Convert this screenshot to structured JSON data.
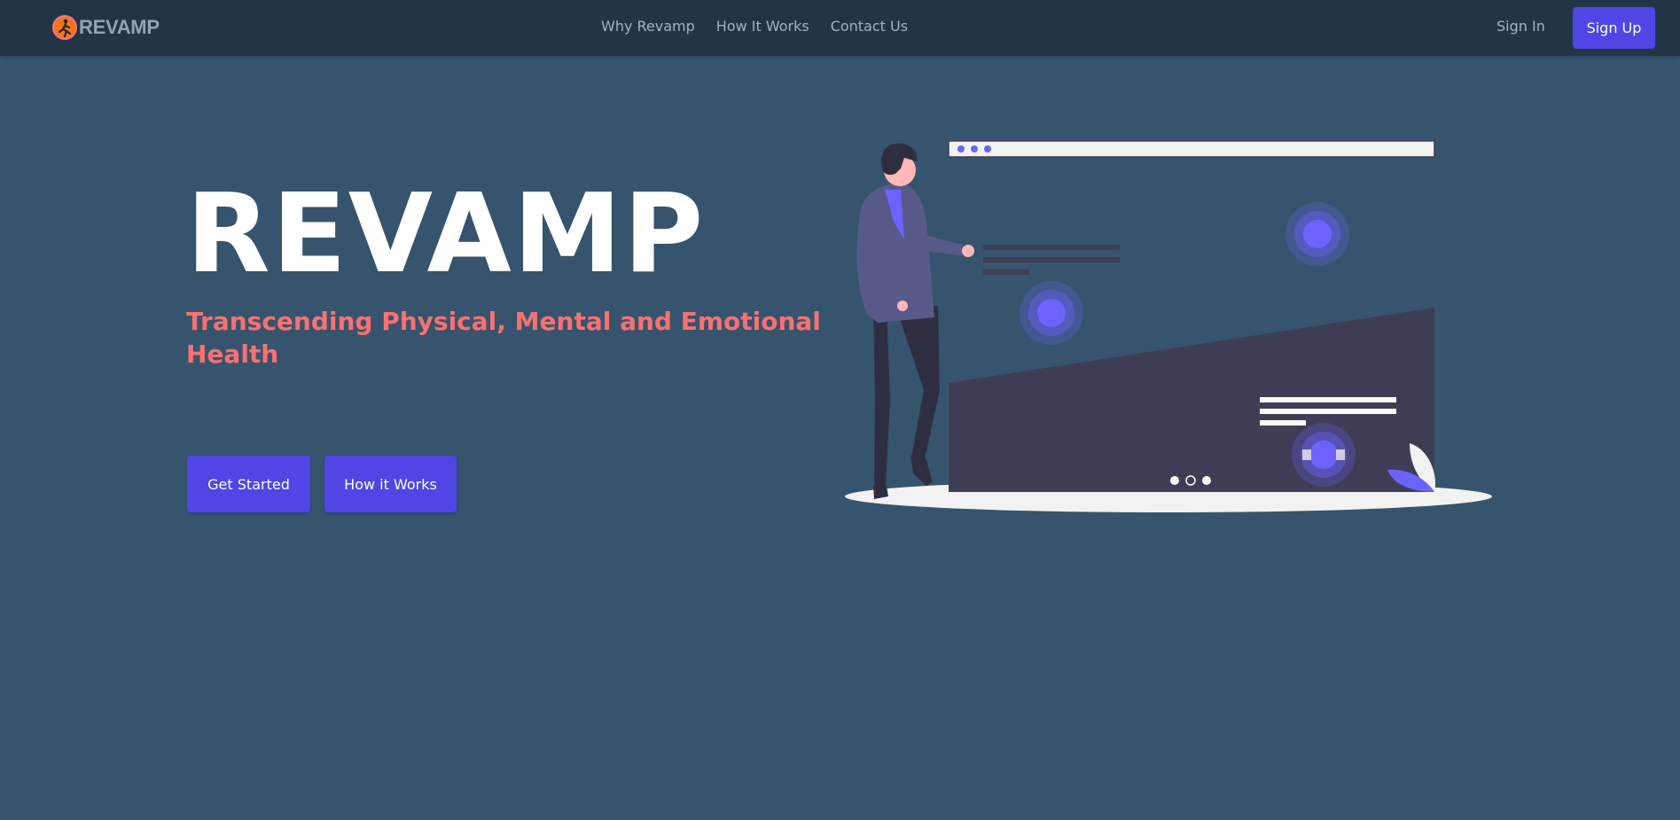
{
  "navbar": {
    "brand": "REVAMP",
    "brand_icon": "running-person-logo-icon",
    "links": [
      "Why Revamp",
      "How It Works",
      "Contact Us"
    ],
    "sign_in": "Sign In",
    "sign_up": "Sign Up"
  },
  "hero": {
    "title": "REVAMP",
    "subtitle": "Transcending Physical, Mental and Emotional Health",
    "buttons": {
      "get_started": "Get Started",
      "how_it_works": "How it Works"
    }
  },
  "colors": {
    "background": "#36546d",
    "navbar": "#223546",
    "accent": "#4f46e5",
    "subtitle": "#f87171",
    "illustration_purple": "#6c63ff",
    "illustration_dark": "#3f3d56"
  },
  "illustration": {
    "name": "presenter-with-website-illustration",
    "carousel_active_index": 1
  }
}
